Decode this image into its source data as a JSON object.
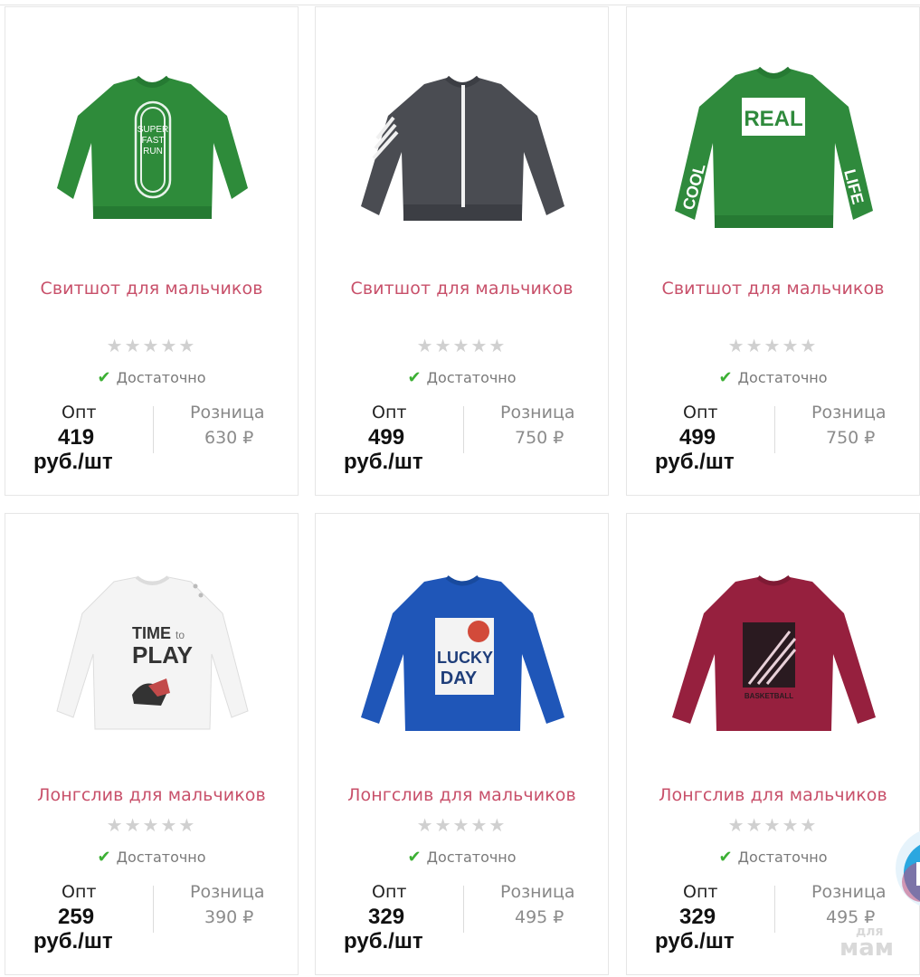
{
  "products": [
    {
      "title": "Свитшот для мальчиков",
      "stock": "Достаточно",
      "opt_label": "Опт",
      "opt_price": "419",
      "opt_unit": "руб./шт",
      "retail_label": "Розница",
      "retail_price": "630 ₽",
      "rating": "★★★★★",
      "image": {
        "type": "sweatshirt",
        "color": "#2e8b3a",
        "print_text": [
          "SUPER",
          "FAST",
          "RUN"
        ]
      }
    },
    {
      "title": "Свитшот для мальчиков",
      "stock": "Достаточно",
      "opt_label": "Опт",
      "opt_price": "499",
      "opt_unit": "руб./шт",
      "retail_label": "Розница",
      "retail_price": "750 ₽",
      "rating": "★★★★★",
      "image": {
        "type": "sweatshirt-zip",
        "color": "#4a4c52",
        "print_text": []
      }
    },
    {
      "title": "Свитшот для мальчиков",
      "stock": "Достаточно",
      "opt_label": "Опт",
      "opt_price": "499",
      "opt_unit": "руб./шт",
      "retail_label": "Розница",
      "retail_price": "750 ₽",
      "rating": "★★★★★",
      "image": {
        "type": "sweatshirt",
        "color": "#2f8a3c",
        "print_text": [
          "REAL",
          "COOL",
          "LIFE"
        ]
      }
    },
    {
      "title": "Лонгслив для мальчиков",
      "stock": "Достаточно",
      "opt_label": "Опт",
      "opt_price": "259",
      "opt_unit": "руб./шт",
      "retail_label": "Розница",
      "retail_price": "390 ₽",
      "rating": "★★★★★",
      "image": {
        "type": "longsleeve",
        "color": "#f4f4f4",
        "print_text": [
          "TIME",
          "to",
          "PLAY"
        ]
      }
    },
    {
      "title": "Лонгслив для мальчиков",
      "stock": "Достаточно",
      "opt_label": "Опт",
      "opt_price": "329",
      "opt_unit": "руб./шт",
      "retail_label": "Розница",
      "retail_price": "495 ₽",
      "rating": "★★★★★",
      "image": {
        "type": "longsleeve",
        "color": "#1f56b8",
        "print_text": [
          "LUCKY",
          "DAY"
        ]
      }
    },
    {
      "title": "Лонгслив для мальчиков",
      "stock": "Достаточно",
      "opt_label": "Опт",
      "opt_price": "329",
      "opt_unit": "руб./шт",
      "retail_label": "Розница",
      "retail_price": "495 ₽",
      "rating": "★★★★★",
      "image": {
        "type": "longsleeve",
        "color": "#96203e",
        "print_text": [
          "BASKETBALL"
        ]
      }
    }
  ],
  "watermark": {
    "line1": "для",
    "line2": "мам"
  },
  "colors": {
    "title": "#c8506a",
    "check": "#3cb034",
    "star": "#d0d0d0",
    "border": "#e6e6e6"
  }
}
